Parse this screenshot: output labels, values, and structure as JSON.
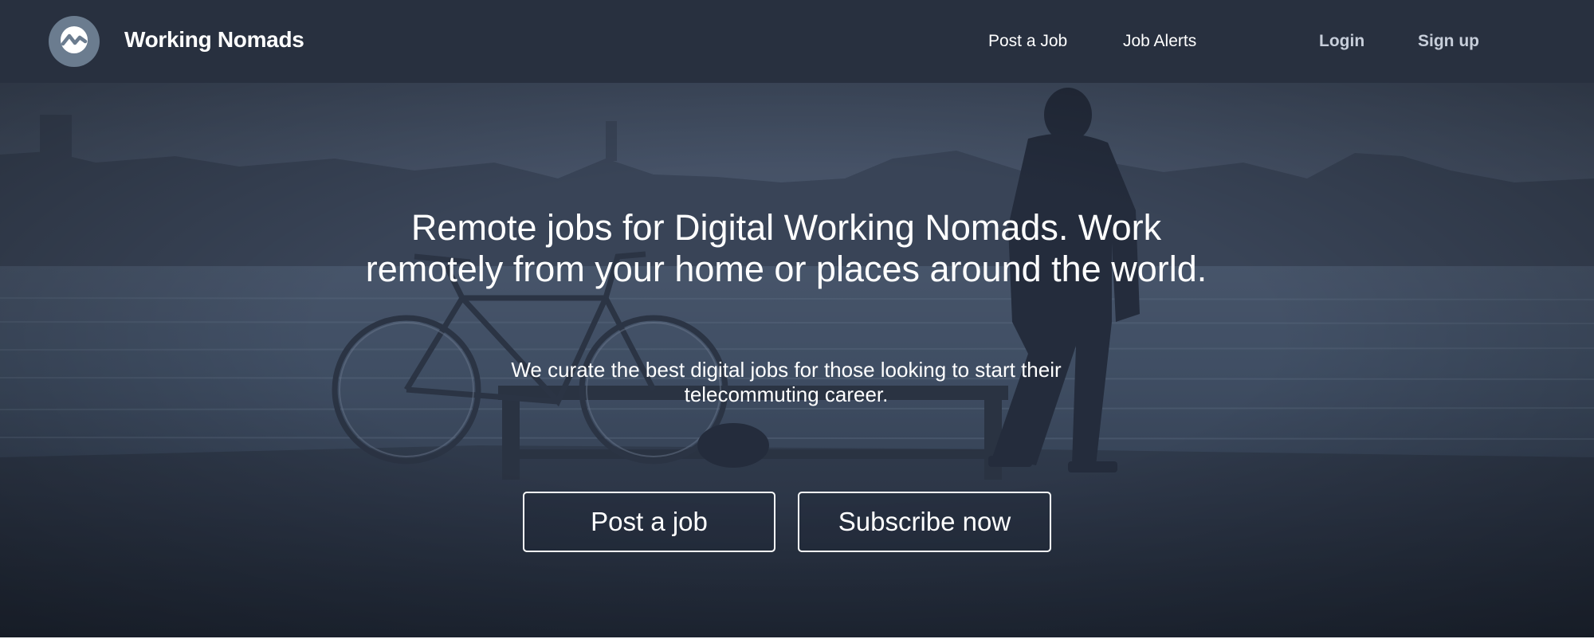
{
  "header": {
    "logo_icon": "wave-logo-icon",
    "brand": "Working Nomads",
    "nav": {
      "post_job": "Post a Job",
      "job_alerts": "Job Alerts",
      "login": "Login",
      "signup": "Sign up"
    }
  },
  "hero": {
    "headline": "Remote jobs for Digital Working Nomads. Work remotely from your home or places around the world.",
    "subline": "We curate the best digital jobs for those looking to start their telecommuting career.",
    "buttons": {
      "post_job": "Post a job",
      "subscribe": "Subscribe now"
    }
  },
  "colors": {
    "header_bg": "#28303f",
    "hero_overlay": "#2e3a4d",
    "text": "#ffffff",
    "logo_circle": "#6b7c8f"
  }
}
